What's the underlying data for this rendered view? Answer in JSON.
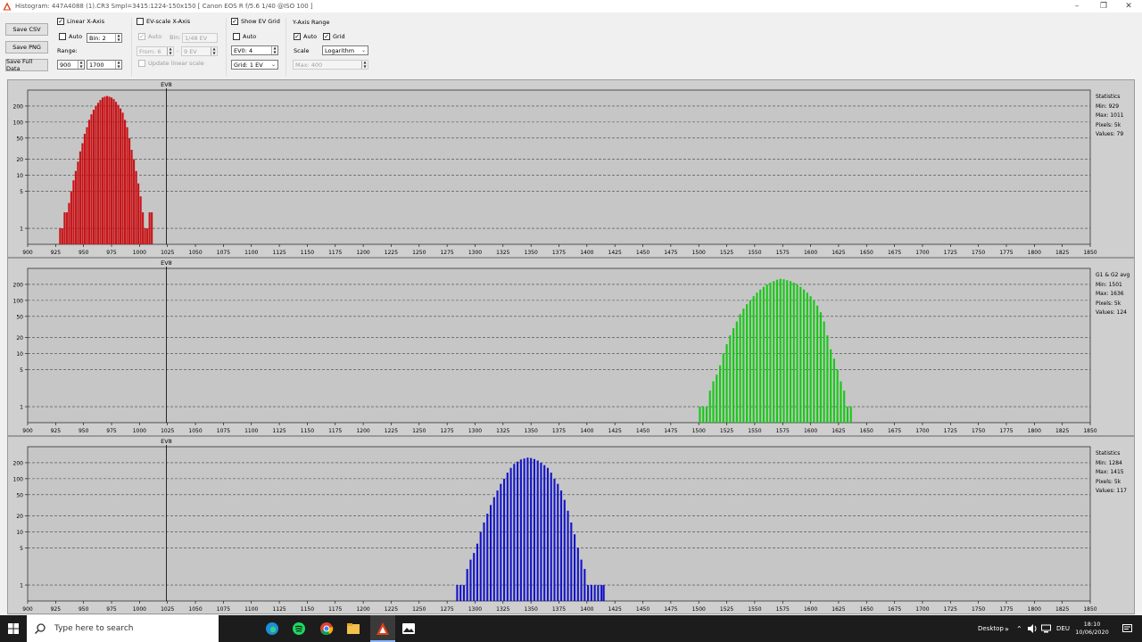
{
  "window": {
    "title": "Histogram: 447A4088 (1).CR3 Smpl=3415:1224-150x150 [ Canon EOS R f/5.6 1/40 @ISO 100 ]",
    "minimize_icon": "minimize-icon",
    "maximize_icon": "restore-icon",
    "close_icon": "close-icon"
  },
  "toolbar": {
    "save_csv": "Save CSV",
    "save_png": "Save PNG",
    "save_full": "Save Full Data",
    "linear": {
      "label": "Linear X-Axis",
      "checked": true,
      "auto_label": "Auto",
      "auto_checked": false,
      "bin": "Bin: 2",
      "range_label": "Range:",
      "range_from": "900",
      "range_to": "1700"
    },
    "ev_scale": {
      "label": "EV-scale X-Axis",
      "checked": false,
      "auto_label": "Auto",
      "auto_checked": true,
      "bin_label": "Bin:",
      "bin": "1/48 EV",
      "from": "From: 6",
      "to_sep": "-",
      "to": "9 EV",
      "update_label": "Update linear scale",
      "update_checked": false
    },
    "ev_grid": {
      "label": "Show EV Grid",
      "checked": true,
      "auto_label": "Auto",
      "auto_checked": false,
      "ev0": "EV0: 4",
      "grid": "Grid: 1 EV"
    },
    "y_axis": {
      "label": "Y-Axis Range",
      "auto_label": "Auto",
      "auto_checked": true,
      "grid_label": "Grid",
      "grid_checked": true,
      "scale_label": "Scale",
      "scale": "Logarithm",
      "max": "Max: 400"
    }
  },
  "chart_data": [
    {
      "type": "bar",
      "channel": "red",
      "color": "#c81418",
      "ev_line_label": "EV8",
      "ev_line_x": 1024,
      "xlim": [
        900,
        1850
      ],
      "xticks": [
        900,
        925,
        950,
        975,
        1000,
        1025,
        1050,
        1075,
        1100,
        1125,
        1150,
        1175,
        1200,
        1225,
        1250,
        1275,
        1300,
        1325,
        1350,
        1375,
        1400,
        1425,
        1450,
        1475,
        1500,
        1525,
        1550,
        1575,
        1600,
        1625,
        1650,
        1675,
        1700,
        1725,
        1750,
        1775,
        1800,
        1825,
        1850
      ],
      "yscale": "log",
      "ylim": [
        0.5,
        400
      ],
      "yticks": [
        1,
        5,
        10,
        20,
        50,
        100,
        200
      ],
      "grid": true,
      "x": [
        929,
        931,
        933,
        935,
        937,
        939,
        941,
        943,
        945,
        947,
        949,
        951,
        953,
        955,
        957,
        959,
        961,
        963,
        965,
        967,
        969,
        971,
        973,
        975,
        977,
        979,
        981,
        983,
        985,
        987,
        989,
        991,
        993,
        995,
        997,
        999,
        1001,
        1003,
        1005,
        1007,
        1009,
        1011
      ],
      "y": [
        1,
        1,
        2,
        2,
        3,
        5,
        8,
        12,
        18,
        28,
        40,
        60,
        80,
        110,
        140,
        170,
        200,
        230,
        260,
        290,
        300,
        310,
        300,
        290,
        270,
        240,
        210,
        180,
        150,
        110,
        80,
        50,
        30,
        20,
        12,
        7,
        4,
        2,
        1,
        1,
        2,
        2
      ],
      "stats_title": "Statistics",
      "stats": [
        "Min: 929",
        "Max: 1011",
        "Pixels: 5k",
        "Values: 79"
      ]
    },
    {
      "type": "bar",
      "channel": "green",
      "color": "#17c817",
      "ev_line_label": "EV8",
      "ev_line_x": 1024,
      "xlim": [
        900,
        1850
      ],
      "xticks": [
        900,
        925,
        950,
        975,
        1000,
        1025,
        1050,
        1075,
        1100,
        1125,
        1150,
        1175,
        1200,
        1225,
        1250,
        1275,
        1300,
        1325,
        1350,
        1375,
        1400,
        1425,
        1450,
        1475,
        1500,
        1525,
        1550,
        1575,
        1600,
        1625,
        1650,
        1675,
        1700,
        1725,
        1750,
        1775,
        1800,
        1825,
        1850
      ],
      "yscale": "log",
      "ylim": [
        0.5,
        400
      ],
      "yticks": [
        1,
        5,
        10,
        20,
        50,
        100,
        200
      ],
      "grid": true,
      "x": [
        1501,
        1504,
        1507,
        1510,
        1513,
        1516,
        1519,
        1522,
        1525,
        1528,
        1531,
        1534,
        1537,
        1540,
        1543,
        1546,
        1549,
        1552,
        1555,
        1558,
        1561,
        1564,
        1567,
        1570,
        1573,
        1576,
        1579,
        1582,
        1585,
        1588,
        1591,
        1594,
        1597,
        1600,
        1603,
        1606,
        1609,
        1612,
        1615,
        1618,
        1621,
        1624,
        1627,
        1630,
        1633,
        1636
      ],
      "y": [
        1,
        1,
        1,
        2,
        3,
        4,
        6,
        10,
        15,
        22,
        30,
        40,
        55,
        70,
        85,
        100,
        120,
        140,
        160,
        180,
        200,
        215,
        230,
        245,
        255,
        250,
        240,
        230,
        215,
        200,
        180,
        160,
        140,
        120,
        100,
        80,
        60,
        40,
        22,
        12,
        8,
        5,
        3,
        2,
        1,
        1
      ],
      "stats_title": "G1 & G2 avg",
      "stats": [
        "Min: 1501",
        "Max: 1636",
        "Pixels: 5k",
        "Values: 124"
      ]
    },
    {
      "type": "bar",
      "channel": "blue",
      "color": "#1414c8",
      "ev_line_label": "EV8",
      "ev_line_x": 1024,
      "xlim": [
        900,
        1850
      ],
      "xticks": [
        900,
        925,
        950,
        975,
        1000,
        1025,
        1050,
        1075,
        1100,
        1125,
        1150,
        1175,
        1200,
        1225,
        1250,
        1275,
        1300,
        1325,
        1350,
        1375,
        1400,
        1425,
        1450,
        1475,
        1500,
        1525,
        1550,
        1575,
        1600,
        1625,
        1650,
        1675,
        1700,
        1725,
        1750,
        1775,
        1800,
        1825,
        1850
      ],
      "yscale": "log",
      "ylim": [
        0.5,
        400
      ],
      "yticks": [
        1,
        5,
        10,
        20,
        50,
        100,
        200
      ],
      "grid": true,
      "x": [
        1284,
        1287,
        1290,
        1293,
        1296,
        1299,
        1302,
        1305,
        1308,
        1311,
        1314,
        1317,
        1320,
        1323,
        1326,
        1329,
        1332,
        1335,
        1338,
        1341,
        1344,
        1347,
        1350,
        1353,
        1356,
        1359,
        1362,
        1365,
        1368,
        1371,
        1374,
        1377,
        1380,
        1383,
        1386,
        1389,
        1392,
        1395,
        1398,
        1401,
        1404,
        1407,
        1410,
        1413,
        1415
      ],
      "y": [
        1,
        1,
        1,
        2,
        3,
        4,
        6,
        10,
        15,
        22,
        32,
        45,
        60,
        80,
        100,
        130,
        160,
        190,
        210,
        230,
        240,
        250,
        245,
        235,
        220,
        200,
        180,
        160,
        130,
        100,
        80,
        60,
        40,
        25,
        15,
        9,
        5,
        3,
        2,
        1,
        1,
        1,
        1,
        1,
        1
      ],
      "stats_title": "Statistics",
      "stats": [
        "Min: 1284",
        "Max: 1415",
        "Pixels: 5k",
        "Values: 117"
      ]
    }
  ],
  "taskbar": {
    "start_icon": "windows-start-icon",
    "search_placeholder": "Type here to search",
    "apps": [
      "edge-icon",
      "spotify-icon",
      "chrome-icon",
      "file-explorer-icon",
      "rawdigger-icon",
      "photos-icon"
    ],
    "desktop_label": "Desktop",
    "language": "DEU",
    "time": "18:10",
    "date": "10/06/2020"
  }
}
